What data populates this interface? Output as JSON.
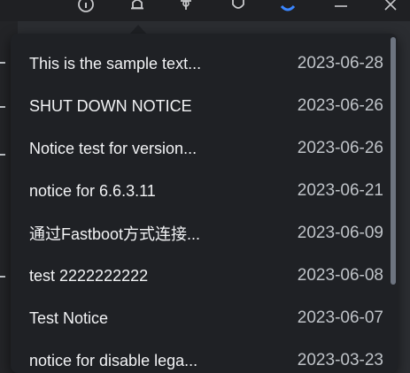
{
  "toolbar": {
    "icons": [
      "info-icon",
      "bell-icon",
      "plugin-icon",
      "shield-icon",
      "user-icon",
      "minimize-icon",
      "close-icon"
    ]
  },
  "notices": [
    {
      "title": "This is the sample text...",
      "date": "2023-06-28"
    },
    {
      "title": "SHUT DOWN NOTICE",
      "date": "2023-06-26"
    },
    {
      "title": "Notice test for version...",
      "date": "2023-06-26"
    },
    {
      "title": "notice for 6.6.3.11",
      "date": "2023-06-21"
    },
    {
      "title": "通过Fastboot方式连接...",
      "date": "2023-06-09"
    },
    {
      "title": "test 2222222222",
      "date": "2023-06-08"
    },
    {
      "title": "Test Notice",
      "date": "2023-06-07"
    },
    {
      "title": "notice for disable lega...",
      "date": "2023-03-23"
    }
  ],
  "colors": {
    "popover_bg": "#1f2125",
    "title_text": "#f2f3f5",
    "date_text": "#bfc3c8",
    "scrollbar": "#6d7480",
    "accent_user": "#3a86ff"
  }
}
